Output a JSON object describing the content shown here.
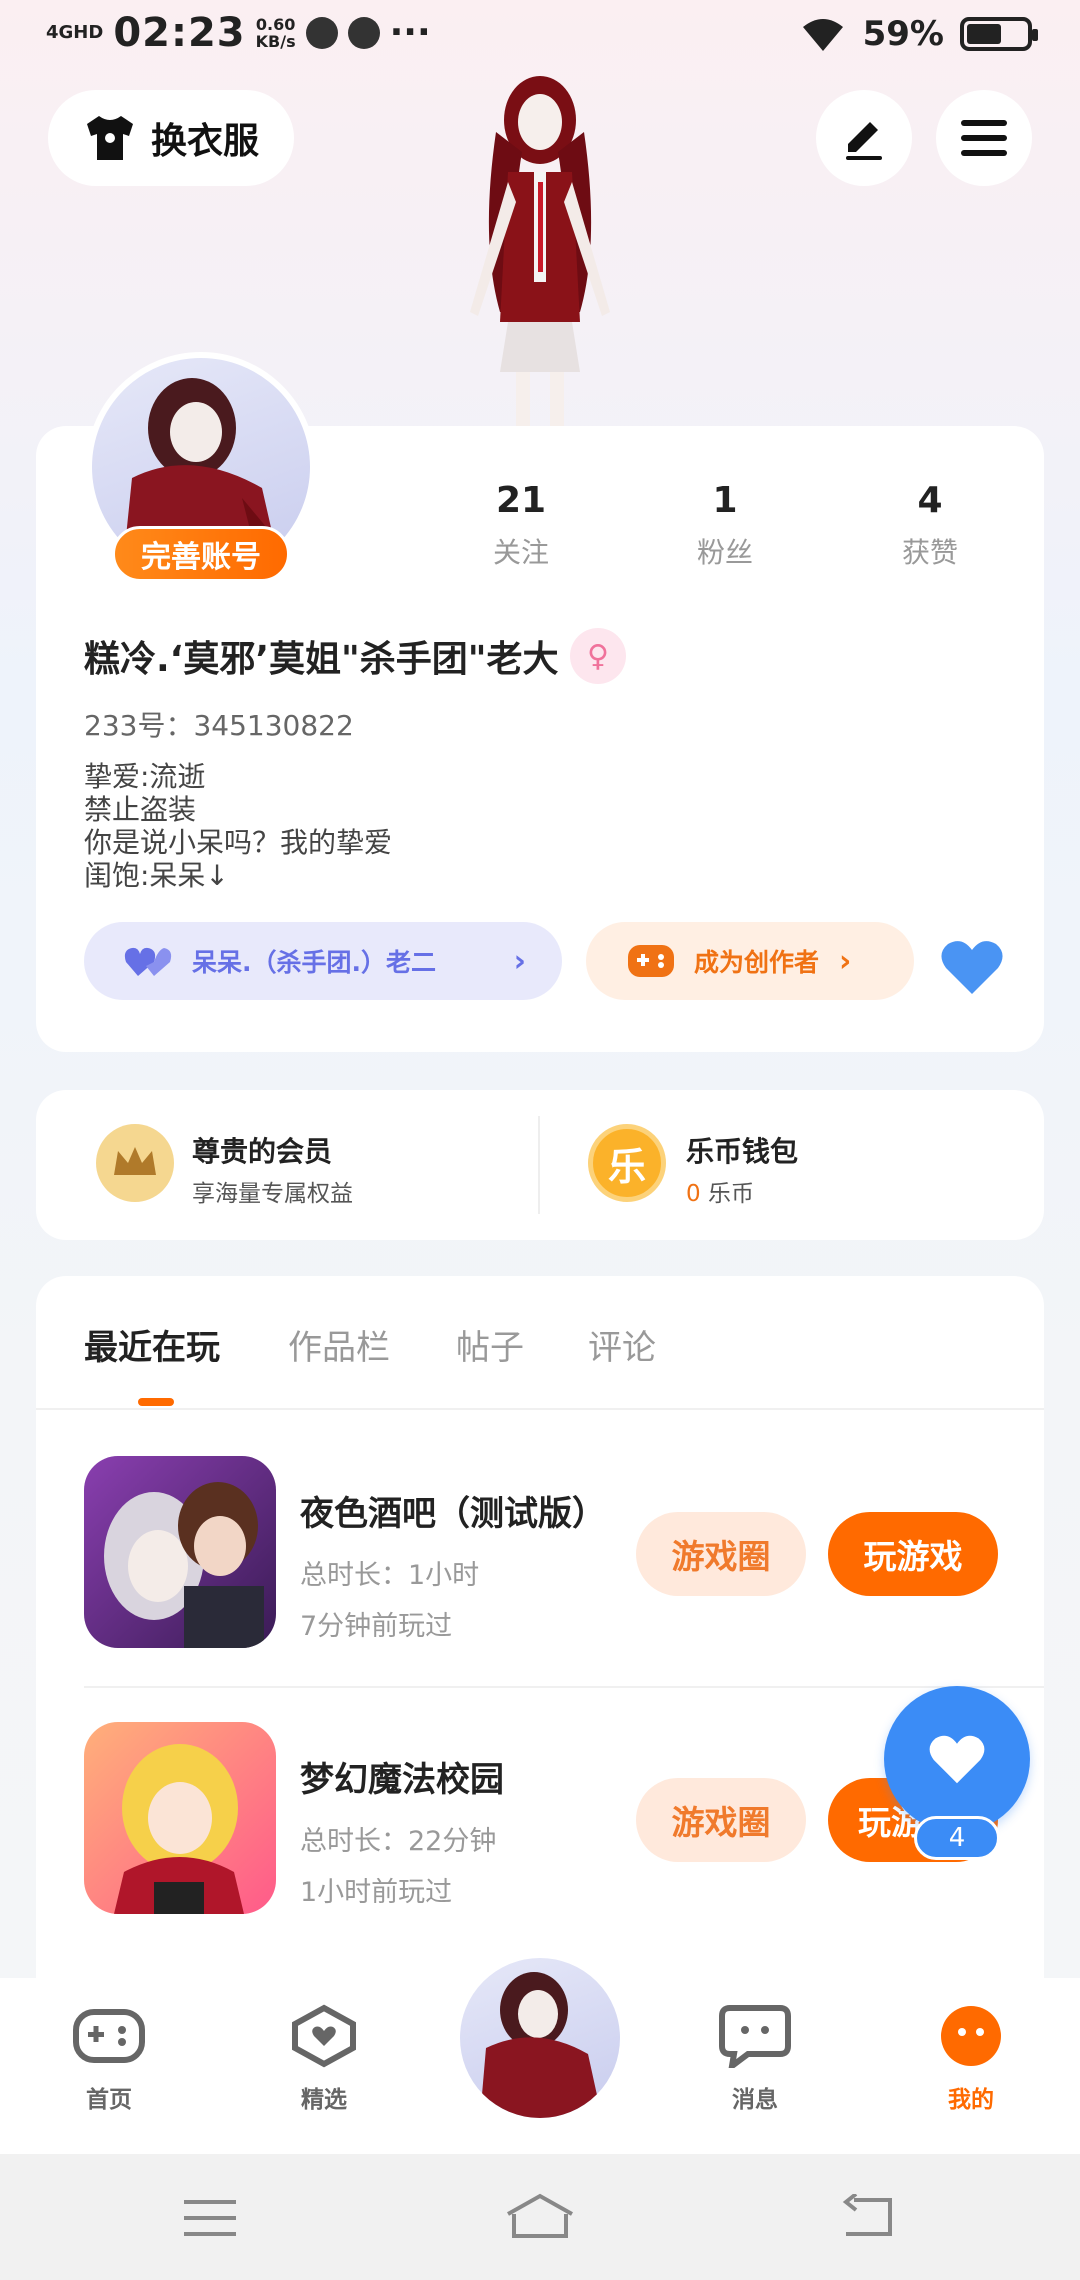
{
  "status_bar": {
    "network": "4GHD",
    "time": "02:23",
    "speed_value": "0.60",
    "speed_unit": "KB/s",
    "more": "···",
    "battery_pct": "59%",
    "battery_level": 0.59
  },
  "top": {
    "dress_label": "换衣服"
  },
  "profile": {
    "complete_label": "完善账号",
    "stats": [
      {
        "num": "21",
        "label": "关注"
      },
      {
        "num": "1",
        "label": "粉丝"
      },
      {
        "num": "4",
        "label": "获赞"
      }
    ],
    "username": "糕冷.‘莫邪’莫姐\"杀手团\"老大",
    "gender_icon": "♀",
    "uid": "233号：345130822",
    "bio": [
      "挚爱:流逝",
      "禁止盗装",
      "你是说小呆吗？我的挚爱",
      "闺饱:呆呆↓"
    ],
    "relation_label": "呆呆.（杀手团.）老二",
    "creator_label": "成为创作者"
  },
  "member": {
    "title": "尊贵的会员",
    "sub": "享海量专属权益",
    "coin_glyph": "乐",
    "wallet_title": "乐币钱包",
    "wallet_amount": "0",
    "wallet_unit": "乐币"
  },
  "tabs": [
    "最近在玩",
    "作品栏",
    "帖子",
    "评论"
  ],
  "games": [
    {
      "title": "夜色酒吧（测试版）",
      "duration": "总时长：1小时",
      "last": "7分钟前玩过",
      "circle": "游戏圈",
      "play": "玩游戏"
    },
    {
      "title": "梦幻魔法校园",
      "duration": "总时长：22分钟",
      "last": "1小时前玩过",
      "circle": "游戏圈",
      "play": "玩游戏"
    }
  ],
  "fab_count": "4",
  "nav": [
    "首页",
    "精选",
    "消息",
    "我的"
  ],
  "colors": {
    "accent": "#ff6a00",
    "blue": "#3b8cf6",
    "purple": "#6670e6"
  }
}
